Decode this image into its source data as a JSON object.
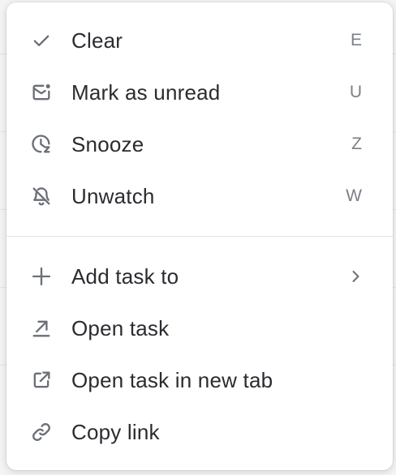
{
  "menu": {
    "group1": [
      {
        "label": "Clear",
        "shortcut": "E",
        "icon": "check-icon"
      },
      {
        "label": "Mark as unread",
        "shortcut": "U",
        "icon": "mail-unread-icon"
      },
      {
        "label": "Snooze",
        "shortcut": "Z",
        "icon": "snooze-clock-icon"
      },
      {
        "label": "Unwatch",
        "shortcut": "W",
        "icon": "bell-off-icon"
      }
    ],
    "group2": [
      {
        "label": "Add task to",
        "icon": "plus-icon",
        "submenu": true
      },
      {
        "label": "Open task",
        "icon": "arrow-up-right-icon"
      },
      {
        "label": "Open task in new tab",
        "icon": "external-link-icon"
      },
      {
        "label": "Copy link",
        "icon": "link-icon"
      }
    ]
  }
}
